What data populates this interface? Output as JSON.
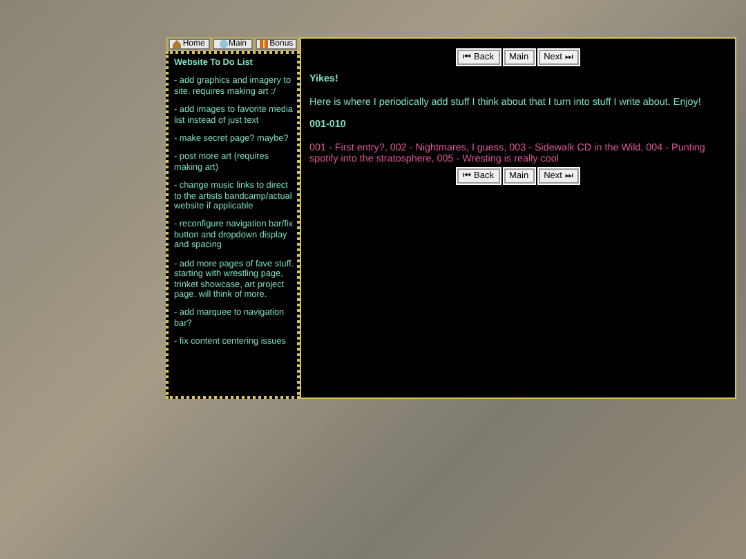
{
  "nav": [
    {
      "label": "Home",
      "kind": "home"
    },
    {
      "label": "Main",
      "kind": "main"
    },
    {
      "label": "Bonus",
      "kind": "bonus"
    }
  ],
  "sidebar": {
    "title": "Website To Do List",
    "items": [
      "- add graphics and imagery to site. requires making art :/",
      "- add images to favorite media list instead of just text",
      "- make secret page? maybe?",
      "- post more art (requires making art)",
      "- change music links to direct to the artists bandcamp/actual website if applicable",
      "- reconfigure navigation bar/fix button and dropdown display and spacing",
      "- add more pages of fave stuff. starting with wrestling page, trinket showcase, art project page. will think of more.",
      "- add marquee to navigation bar?",
      "- fix content centering issues"
    ]
  },
  "pager_top": [
    "⏮ Back",
    "Main",
    "Next ⏭"
  ],
  "heading": "Yikes!",
  "intro": "Here is where I periodically add stuff I think about that I turn into stuff I write about. Enjoy!",
  "section": "001-010",
  "entries": "001 - First entry?, 002 - Nightmares, I guess, 003 - Sidewalk CD in the Wild, 004 - Punting spotify into the stratosphere, 005 - Wresting is really cool",
  "pager_bottom": [
    "⏮ Back",
    "Main",
    "Next ⏭"
  ]
}
